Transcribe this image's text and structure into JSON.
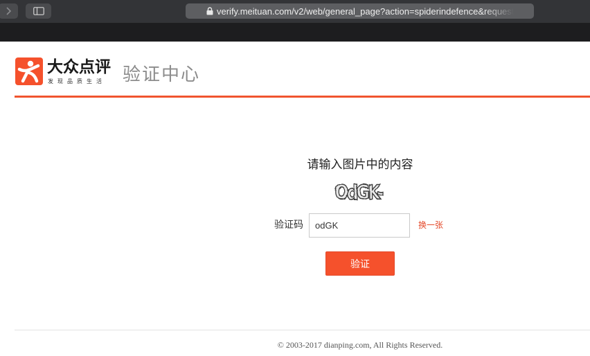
{
  "browser": {
    "url": "verify.meituan.com/v2/web/general_page?action=spiderindefence&request"
  },
  "header": {
    "brand_name": "大众点评",
    "brand_slogan": "发现品质生活",
    "page_title": "验证中心"
  },
  "captcha": {
    "prompt": "请输入图片中的内容",
    "image_text": "OdGK-",
    "code_label": "验证码",
    "input_value": "odGK",
    "refresh_label": "换一张",
    "submit_label": "验证"
  },
  "footer": {
    "copyright": "© 2003-2017 dianping.com, All Rights Reserved."
  },
  "colors": {
    "accent": "#f5512c",
    "brand": "#f0542e",
    "toolbar": "#333437"
  }
}
